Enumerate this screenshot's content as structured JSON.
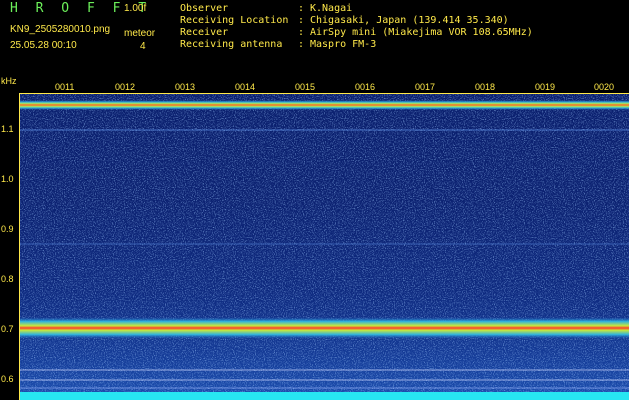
{
  "header": {
    "app_title": "H R O F F T",
    "version": "1.00f",
    "filename": "KN9_2505280010.png",
    "datetime": "25.05.28 00:10",
    "meteor_label": "meteor",
    "meteor_count": "4",
    "info": [
      {
        "key": "Observer",
        "value": "K.Nagai"
      },
      {
        "key": "Receiving Location",
        "value": "Chigasaki, Japan (139.414 35.340)"
      },
      {
        "key": "Receiver",
        "value": "AirSpy mini (Miakejima VOR 108.65MHz)"
      },
      {
        "key": "Receiving antenna",
        "value": "Maspro FM-3"
      }
    ]
  },
  "axis": {
    "unit": "kHz",
    "y_labels": [
      "1.1",
      "1.0",
      "0.9",
      "0.8",
      "0.7",
      "0.6"
    ],
    "x_labels": [
      "0011",
      "0012",
      "0013",
      "0014",
      "0015",
      "0016",
      "0017",
      "0018",
      "0019",
      "0020"
    ]
  },
  "colors": {
    "label": "#ffe94a",
    "title": "#6cf05a",
    "noise": "#1b3a9e",
    "band": "#ff3a2a"
  }
}
